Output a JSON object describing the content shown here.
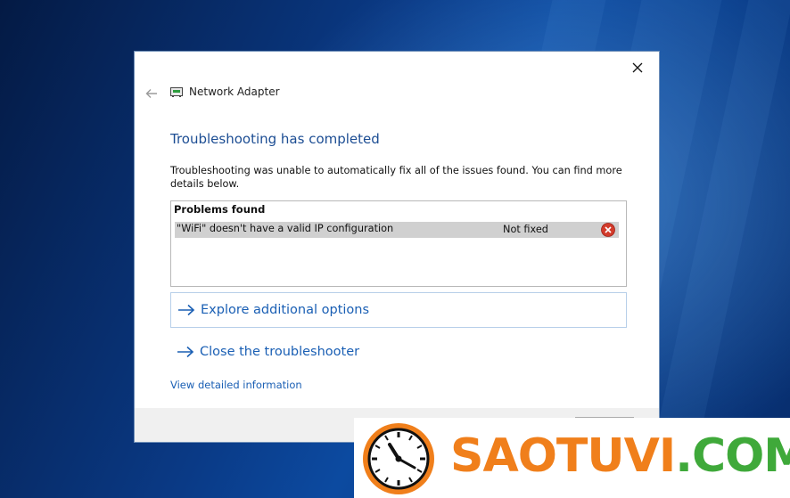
{
  "window": {
    "title": "Network Adapter"
  },
  "content": {
    "heading": "Troubleshooting has completed",
    "description": "Troubleshooting was unable to automatically fix all of the issues found. You can find more details below.",
    "problems": {
      "header": "Problems found",
      "items": [
        {
          "text": "\"WiFi\" doesn't have a valid IP configuration",
          "status": "Not fixed",
          "status_icon": "error-icon"
        }
      ]
    },
    "options": [
      {
        "label": "Explore additional options",
        "icon": "arrow-right-icon"
      },
      {
        "label": "Close the troubleshooter",
        "icon": "arrow-right-icon"
      }
    ],
    "detail_link": "View detailed information"
  },
  "watermark": {
    "part1": "SAOTUVI",
    "part2": ".COM"
  },
  "colors": {
    "heading": "#1c4d93",
    "link": "#1a5fb4",
    "error": "#d23b2b",
    "watermark_orange": "#f07f1b",
    "watermark_green": "#3fa93a",
    "desktop": "#0a3a86"
  }
}
